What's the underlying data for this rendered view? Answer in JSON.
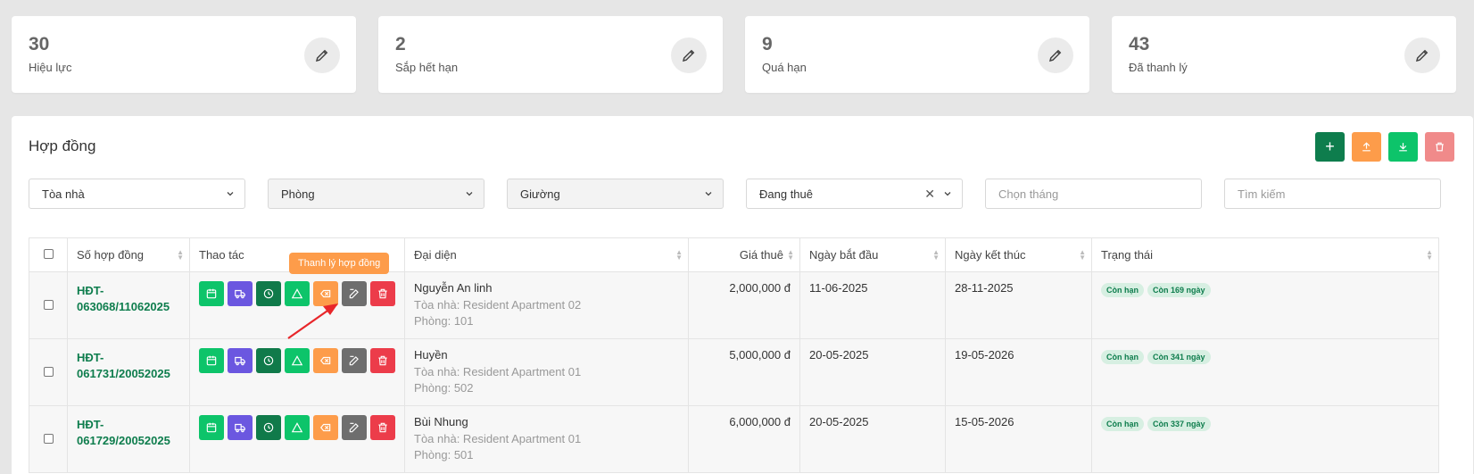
{
  "stats": [
    {
      "value": "30",
      "label": "Hiệu lực"
    },
    {
      "value": "2",
      "label": "Sắp hết hạn"
    },
    {
      "value": "9",
      "label": "Quá hạn"
    },
    {
      "value": "43",
      "label": "Đã thanh lý"
    }
  ],
  "panel": {
    "title": "Hợp đồng"
  },
  "header_buttons": {
    "add": "+",
    "upload": "upload-icon",
    "download": "download-icon",
    "delete": "trash-icon"
  },
  "filters": {
    "building": "Tòa nhà",
    "room": "Phòng",
    "bed": "Giường",
    "status": "Đang thuê",
    "month_placeholder": "Chọn tháng",
    "search_placeholder": "Tìm kiếm"
  },
  "table": {
    "columns": [
      "Số hợp đồng",
      "Thao tác",
      "Đại diện",
      "Giá thuê",
      "Ngày bắt đầu",
      "Ngày kết thúc",
      "Trạng thái"
    ],
    "rows": [
      {
        "code_line1": "HĐT-",
        "code_line2": "063068/11062025",
        "name": "Nguyễn An linh",
        "building": "Tòa nhà: Resident Apartment 02",
        "room": "Phòng: 101",
        "price": "2,000,000 đ",
        "start": "11-06-2025",
        "end": "28-11-2025",
        "status": "Còn hạn",
        "remaining": "Còn 169 ngày"
      },
      {
        "code_line1": "HĐT-",
        "code_line2": "061731/20052025",
        "name": "Huyền",
        "building": "Tòa nhà: Resident Apartment 01",
        "room": "Phòng: 502",
        "price": "5,000,000 đ",
        "start": "20-05-2025",
        "end": "19-05-2026",
        "status": "Còn hạn",
        "remaining": "Còn 341 ngày"
      },
      {
        "code_line1": "HĐT-",
        "code_line2": "061729/20052025",
        "name": "Bùi Nhung",
        "building": "Tòa nhà: Resident Apartment 01",
        "room": "Phòng: 501",
        "price": "6,000,000 đ",
        "start": "20-05-2025",
        "end": "15-05-2026",
        "status": "Còn hạn",
        "remaining": "Còn 337 ngày"
      }
    ]
  },
  "tooltip": "Thanh lý hợp đồng",
  "colors": {
    "accent_green": "#0e7d4d",
    "orange": "#fd9c4a",
    "purple": "#6b57e0",
    "red": "#ec3c4a"
  }
}
